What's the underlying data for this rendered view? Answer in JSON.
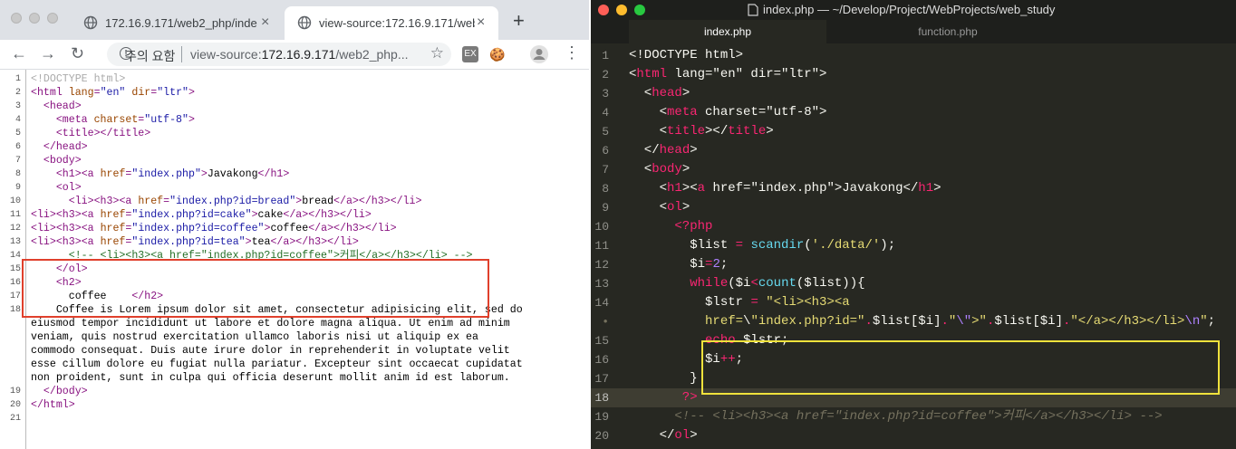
{
  "browser": {
    "tabs": [
      {
        "title": "172.16.9.171/web2_php/index.php",
        "icon": "globe-icon"
      },
      {
        "title": "view-source:172.16.9.171/web2_php/index.php",
        "icon": "globe-icon"
      }
    ],
    "new_tab": "+",
    "close_glyph": "×",
    "nav": {
      "back": "←",
      "forward": "→",
      "reload": "↻"
    },
    "address": {
      "warning_icon": "!",
      "warning_text": "주의 요함",
      "prefix": "view-source:",
      "host": "172.16.9.171",
      "path": "/web2_php...",
      "star": "☆"
    },
    "extensions": [
      {
        "label": "EX",
        "color": "#7a7a7a"
      },
      {
        "label": "🍪",
        "color": "#ffffff"
      }
    ],
    "menu_glyph": "⋮"
  },
  "view_source": {
    "lines": [
      {
        "n": "1",
        "text": "<!DOCTYPE html>"
      },
      {
        "n": "2",
        "text": "<html lang=\"en\" dir=\"ltr\">"
      },
      {
        "n": "3",
        "text": "  <head>"
      },
      {
        "n": "4",
        "text": "    <meta charset=\"utf-8\">"
      },
      {
        "n": "5",
        "text": "    <title></title>"
      },
      {
        "n": "6",
        "text": "  </head>"
      },
      {
        "n": "7",
        "text": "  <body>"
      },
      {
        "n": "8",
        "text": "    <h1><a href=\"index.php\">Javakong</h1>"
      },
      {
        "n": "9",
        "text": "    <ol>"
      },
      {
        "n": "10",
        "text": "      <li><h3><a href=\"index.php?id=bread\">bread</a></h3></li>"
      },
      {
        "n": "11",
        "text": "<li><h3><a href=\"index.php?id=cake\">cake</a></h3></li>"
      },
      {
        "n": "12",
        "text": "<li><h3><a href=\"index.php?id=coffee\">coffee</a></h3></li>"
      },
      {
        "n": "13",
        "text": "<li><h3><a href=\"index.php?id=tea\">tea</a></h3></li>"
      },
      {
        "n": "14",
        "text": "      <!-- <li><h3><a href=\"index.php?id=coffee\">커피</a></h3></li> -->"
      },
      {
        "n": "15",
        "text": "    </ol>"
      },
      {
        "n": "16",
        "text": "    <h2>"
      },
      {
        "n": "17",
        "text": "      coffee    </h2>"
      },
      {
        "n": "18",
        "text": "    Coffee is Lorem ipsum dolor sit amet, consectetur adipisicing elit, sed do"
      },
      {
        "n": "",
        "text": "eiusmod tempor incididunt ut labore et dolore magna aliqua. Ut enim ad minim"
      },
      {
        "n": "",
        "text": "veniam, quis nostrud exercitation ullamco laboris nisi ut aliquip ex ea"
      },
      {
        "n": "",
        "text": "commodo consequat. Duis aute irure dolor in reprehenderit in voluptate velit"
      },
      {
        "n": "",
        "text": "esse cillum dolore eu fugiat nulla pariatur. Excepteur sint occaecat cupidatat"
      },
      {
        "n": "",
        "text": "non proident, sunt in culpa qui officia deserunt mollit anim id est laborum."
      },
      {
        "n": "19",
        "text": "  </body>"
      },
      {
        "n": "20",
        "text": "</html>"
      },
      {
        "n": "21",
        "text": ""
      }
    ]
  },
  "editor": {
    "window_title": "index.php — ~/Develop/Project/WebProjects/web_study",
    "tabs": [
      {
        "label": "index.php"
      },
      {
        "label": "function.php"
      }
    ],
    "current_line": "18",
    "lines": [
      {
        "n": "1",
        "text": "<!DOCTYPE html>"
      },
      {
        "n": "2",
        "text": "<html lang=\"en\" dir=\"ltr\">"
      },
      {
        "n": "3",
        "text": "  <head>"
      },
      {
        "n": "4",
        "text": "    <meta charset=\"utf-8\">"
      },
      {
        "n": "5",
        "text": "    <title></title>"
      },
      {
        "n": "6",
        "text": "  </head>"
      },
      {
        "n": "7",
        "text": "  <body>"
      },
      {
        "n": "8",
        "text": "    <h1><a href=\"index.php\">Javakong</h1>"
      },
      {
        "n": "9",
        "text": "    <ol>"
      },
      {
        "n": "10",
        "text": "      <?php"
      },
      {
        "n": "11",
        "text": "        $list = scandir('./data/');"
      },
      {
        "n": "12",
        "text": "        $i=2;"
      },
      {
        "n": "13",
        "text": "        while($i<count($list)){"
      },
      {
        "n": "14",
        "text": "          $lstr = \"<li><h3><a"
      },
      {
        "n": "•",
        "text": "          href=\\\"index.php?id=\".$list[$i].\"\\\">\".$list[$i].\"</a></h3></li>\\n\";"
      },
      {
        "n": "15",
        "text": "          echo $lstr;"
      },
      {
        "n": "16",
        "text": "          $i++;"
      },
      {
        "n": "17",
        "text": "        }"
      },
      {
        "n": "18",
        "text": "       ?>"
      },
      {
        "n": "19",
        "text": "      <!-- <li><h3><a href=\"index.php?id=coffee\">커피</a></h3></li> -->"
      },
      {
        "n": "20",
        "text": "    </ol>"
      }
    ]
  },
  "highlight_colors": {
    "red_box": "#e0402c",
    "yellow_box": "#f0e23c"
  }
}
